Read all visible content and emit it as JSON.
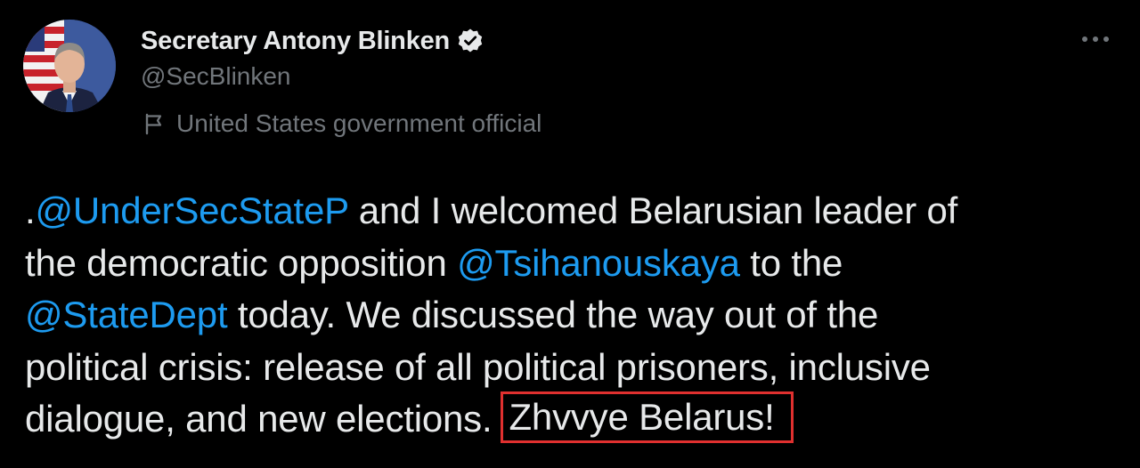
{
  "author": {
    "display_name": "Secretary Antony Blinken",
    "handle": "@SecBlinken",
    "label": "United States government official",
    "verified_icon": "verified-badge-icon",
    "label_icon": "flag-icon"
  },
  "tweet": {
    "line1": {
      "prefix": ".",
      "mention": "@UnderSecStateP",
      "text": " and I welcomed Belarusian leader of"
    },
    "line2": {
      "text": "the democratic opposition ",
      "mention": "@Tsihanouskaya",
      "suffix": " to the"
    },
    "line3": {
      "mention": "@StateDept",
      "text": " today. We discussed the way out of the"
    },
    "line4": {
      "text": "political crisis: release of all political prisoners, inclusive"
    },
    "line5": {
      "text": "dialogue, and new elections.",
      "highlighted": "Zhvvye Belarus!"
    }
  },
  "colors": {
    "background": "#000000",
    "primary_text": "#e7e9ea",
    "secondary_text": "#71767b",
    "mention": "#1d9bf0",
    "highlight_border": "#e0302f"
  },
  "menu": {
    "icon": "more-options-icon"
  }
}
